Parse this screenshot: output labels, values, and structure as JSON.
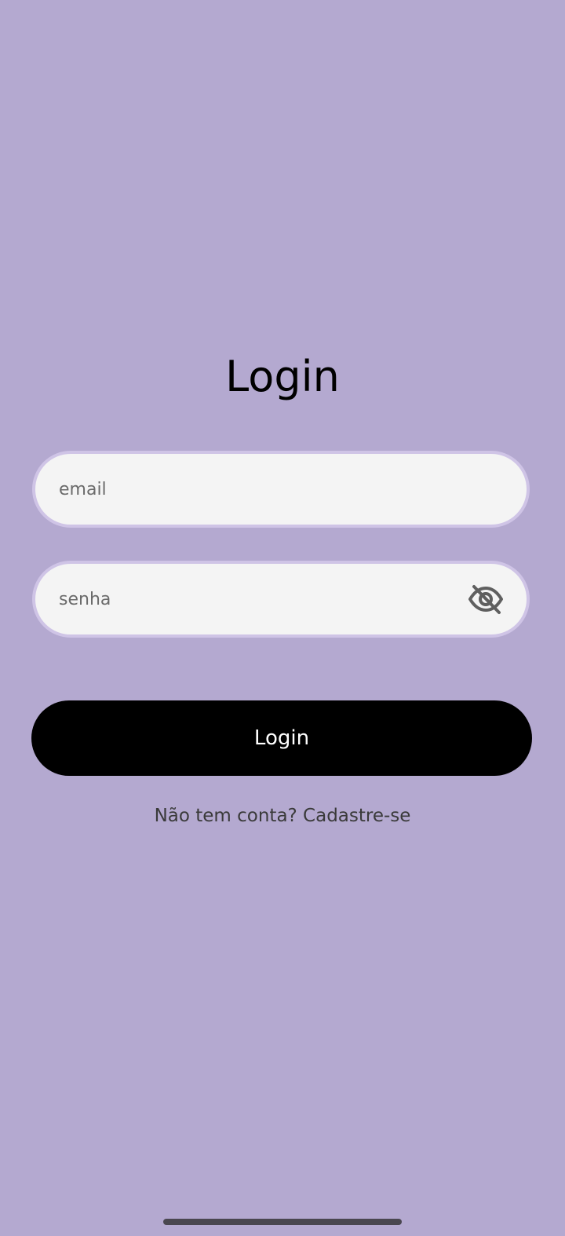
{
  "screen": {
    "title": "Login",
    "background_color": "#b4a9d0"
  },
  "form": {
    "email": {
      "placeholder": "email",
      "value": ""
    },
    "password": {
      "placeholder": "senha",
      "value": "",
      "visibility_icon": "eye-off-icon"
    },
    "submit_label": "Login",
    "signup_text": "Não tem conta? Cadastre-se"
  },
  "colors": {
    "field_background": "#f4f4f4",
    "field_border": "#cfc4e6",
    "button_background": "#000000",
    "button_text": "#ffffff"
  }
}
